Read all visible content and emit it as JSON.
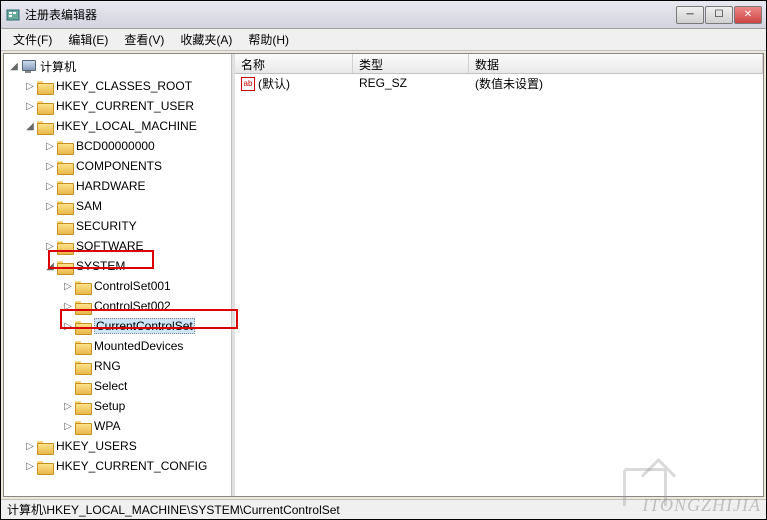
{
  "window": {
    "title": "注册表编辑器"
  },
  "menu": {
    "file": "文件(F)",
    "edit": "编辑(E)",
    "view": "查看(V)",
    "favorites": "收藏夹(A)",
    "help": "帮助(H)"
  },
  "tree": {
    "root": "计算机",
    "hkcr": "HKEY_CLASSES_ROOT",
    "hkcu": "HKEY_CURRENT_USER",
    "hklm": "HKEY_LOCAL_MACHINE",
    "hklm_children": {
      "bcd": "BCD00000000",
      "components": "COMPONENTS",
      "hardware": "HARDWARE",
      "sam": "SAM",
      "security": "SECURITY",
      "software": "SOFTWARE",
      "system": "SYSTEM"
    },
    "system_children": {
      "cs1": "ControlSet001",
      "cs2": "ControlSet002",
      "ccs": "CurrentControlSet",
      "mounted": "MountedDevices",
      "rng": "RNG",
      "select": "Select",
      "setup": "Setup",
      "wpa": "WPA"
    },
    "hku": "HKEY_USERS",
    "hkcc": "HKEY_CURRENT_CONFIG"
  },
  "list": {
    "headers": {
      "name": "名称",
      "type": "类型",
      "data": "数据"
    },
    "rows": [
      {
        "icon": "ab",
        "name": "(默认)",
        "type": "REG_SZ",
        "data": "(数值未设置)"
      }
    ]
  },
  "statusbar": {
    "path": "计算机\\HKEY_LOCAL_MACHINE\\SYSTEM\\CurrentControlSet"
  },
  "watermark": "ITONGZHIJIA"
}
